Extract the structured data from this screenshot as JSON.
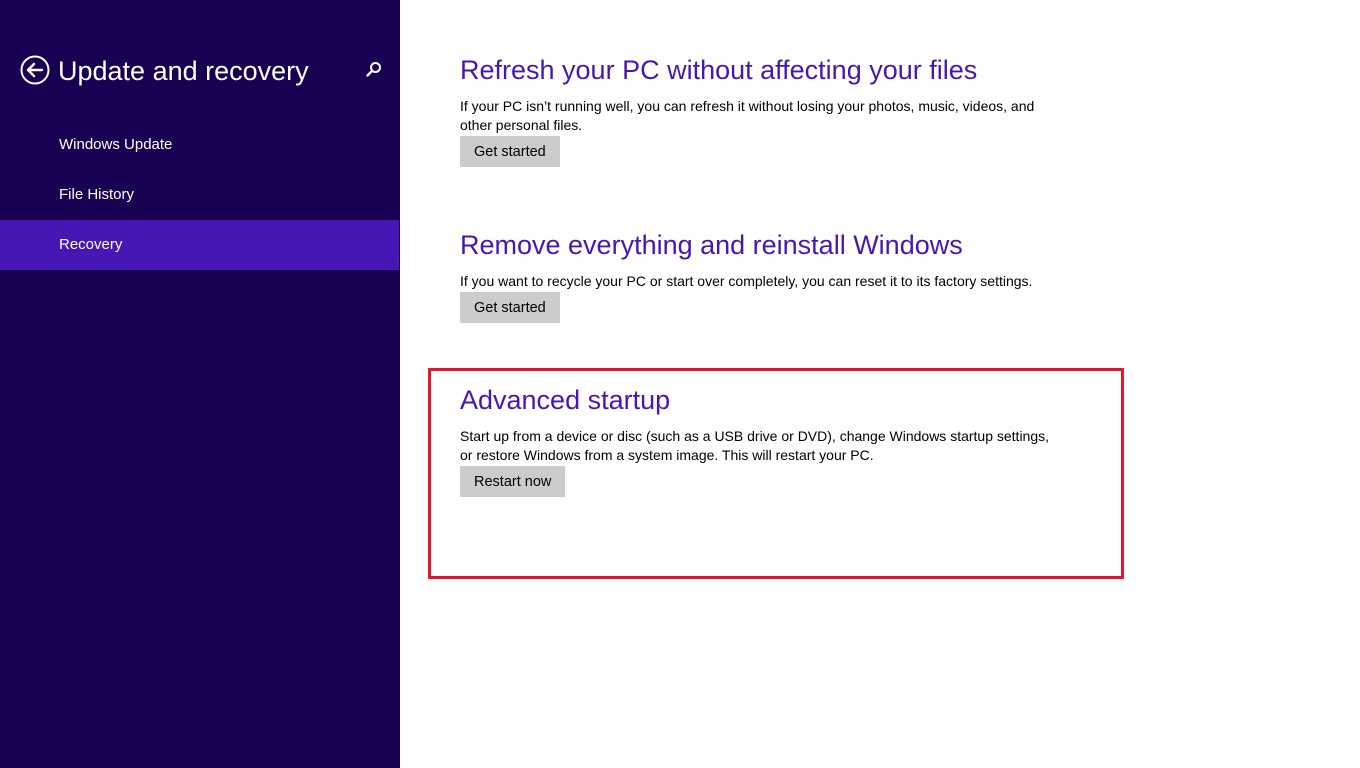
{
  "sidebar": {
    "title": "Update and recovery",
    "back_icon": "back-arrow-icon",
    "search_icon": "search-icon",
    "background_color": "#180052",
    "selected_color": "#4617b4",
    "items": [
      {
        "label": "Windows Update",
        "active": false
      },
      {
        "label": "File History",
        "active": false
      },
      {
        "label": "Recovery",
        "active": true
      }
    ]
  },
  "main": {
    "accent_color": "#4617b4",
    "sections": [
      {
        "title": "Refresh your PC without affecting your files",
        "description": "If your PC isn’t running well, you can refresh it without losing your photos, music, videos, and other personal files.",
        "button_label": "Get started"
      },
      {
        "title": "Remove everything and reinstall Windows",
        "description": "If you want to recycle your PC or start over completely, you can reset it to its factory settings.",
        "button_label": "Get started"
      },
      {
        "title": "Advanced startup",
        "description": "Start up from a device or disc (such as a USB drive or DVD), change Windows startup settings, or restore Windows from a system image. This will restart your PC.",
        "button_label": "Restart now"
      }
    ],
    "highlight_color": "#e3182d"
  }
}
